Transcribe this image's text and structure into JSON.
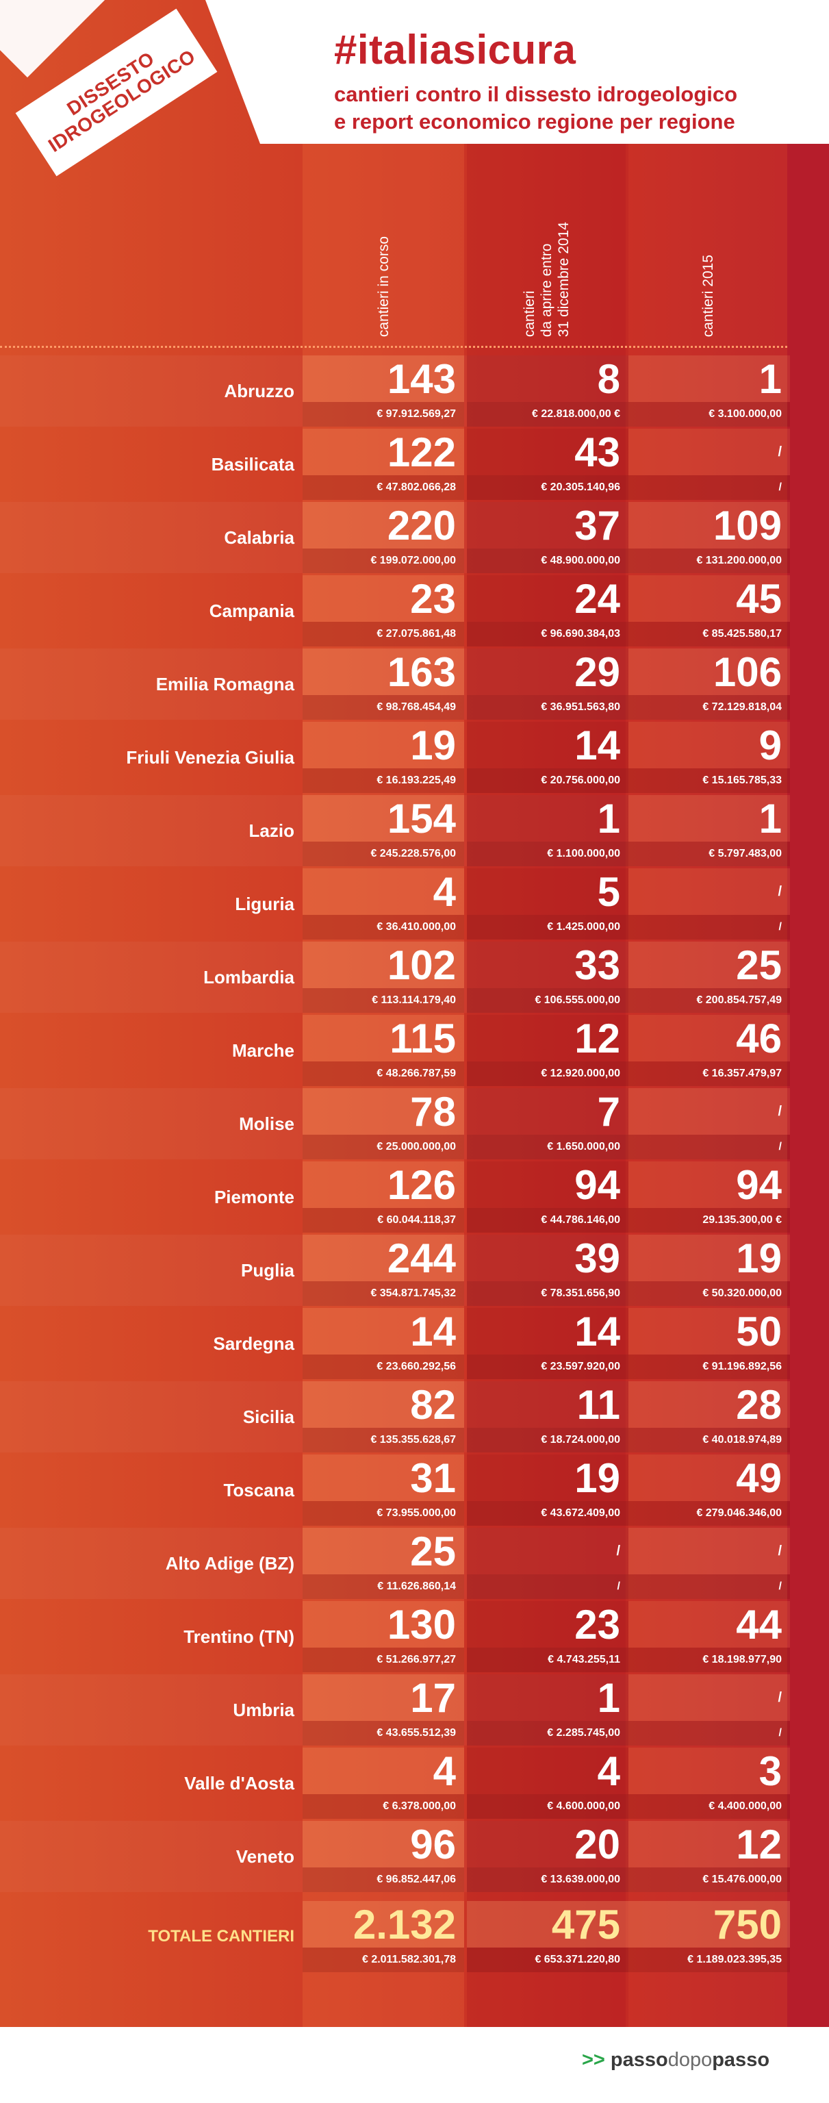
{
  "header": {
    "tag_line1": "DISSESTO",
    "tag_line2": "IDROGEOLOGICO",
    "title": "#italiasicura",
    "subtitle_line1": "cantieri contro il dissesto idrogeologico",
    "subtitle_line2": "e report economico regione per regione"
  },
  "columns": {
    "c1": "cantieri in corso",
    "c2_line1": "cantieri",
    "c2_line2": "da aprire entro",
    "c2_line3": "31 dicembre 2014",
    "c3": "cantieri 2015"
  },
  "colors": {
    "title_red": "#c4222a",
    "total_yellow": "#ffe89a",
    "logo_green": "#2aa64a"
  },
  "chart_data": {
    "type": "table",
    "title": "#italiasicura",
    "series_names": [
      "cantieri in corso",
      "cantieri da aprire entro 31 dicembre 2014",
      "cantieri 2015"
    ],
    "rows": [
      {
        "region": "Abruzzo",
        "v": [
          "143",
          "8",
          "1"
        ],
        "a": [
          "€ 97.912.569,27",
          "€ 22.818.000,00 €",
          "€ 3.100.000,00"
        ]
      },
      {
        "region": "Basilicata",
        "v": [
          "122",
          "43",
          ""
        ],
        "a": [
          "€ 47.802.066,28",
          "€ 20.305.140,96",
          "/"
        ],
        "top3": "/"
      },
      {
        "region": "Calabria",
        "v": [
          "220",
          "37",
          "109"
        ],
        "a": [
          "€ 199.072.000,00",
          "€ 48.900.000,00",
          "€ 131.200.000,00"
        ]
      },
      {
        "region": "Campania",
        "v": [
          "23",
          "24",
          "45"
        ],
        "a": [
          "€ 27.075.861,48",
          "€ 96.690.384,03",
          "€ 85.425.580,17"
        ]
      },
      {
        "region": "Emilia Romagna",
        "v": [
          "163",
          "29",
          "106"
        ],
        "a": [
          "€ 98.768.454,49",
          "€ 36.951.563,80",
          "€ 72.129.818,04"
        ]
      },
      {
        "region": "Friuli Venezia Giulia",
        "v": [
          "19",
          "14",
          "9"
        ],
        "a": [
          "€ 16.193.225,49",
          "€ 20.756.000,00",
          "€ 15.165.785,33"
        ]
      },
      {
        "region": "Lazio",
        "v": [
          "154",
          "1",
          "1"
        ],
        "a": [
          "€ 245.228.576,00",
          "€ 1.100.000,00",
          "€ 5.797.483,00"
        ]
      },
      {
        "region": "Liguria",
        "v": [
          "4",
          "5",
          ""
        ],
        "a": [
          "€ 36.410.000,00",
          "€ 1.425.000,00",
          "/"
        ],
        "top3": "/"
      },
      {
        "region": "Lombardia",
        "v": [
          "102",
          "33",
          "25"
        ],
        "a": [
          "€ 113.114.179,40",
          "€ 106.555.000,00",
          "€ 200.854.757,49"
        ]
      },
      {
        "region": "Marche",
        "v": [
          "115",
          "12",
          "46"
        ],
        "a": [
          "€ 48.266.787,59",
          "€ 12.920.000,00",
          "€ 16.357.479,97"
        ]
      },
      {
        "region": "Molise",
        "v": [
          "78",
          "7",
          ""
        ],
        "a": [
          "€ 25.000.000,00",
          "€ 1.650.000,00",
          "/"
        ],
        "top3": "/"
      },
      {
        "region": "Piemonte",
        "v": [
          "126",
          "94",
          "94"
        ],
        "a": [
          "€ 60.044.118,37",
          "€ 44.786.146,00",
          "29.135.300,00 €"
        ]
      },
      {
        "region": "Puglia",
        "v": [
          "244",
          "39",
          "19"
        ],
        "a": [
          "€ 354.871.745,32",
          "€ 78.351.656,90",
          "€ 50.320.000,00"
        ]
      },
      {
        "region": "Sardegna",
        "v": [
          "14",
          "14",
          "50"
        ],
        "a": [
          "€ 23.660.292,56",
          "€ 23.597.920,00",
          "€ 91.196.892,56"
        ]
      },
      {
        "region": "Sicilia",
        "v": [
          "82",
          "11",
          "28"
        ],
        "a": [
          "€ 135.355.628,67",
          "€ 18.724.000,00",
          "€ 40.018.974,89"
        ]
      },
      {
        "region": "Toscana",
        "v": [
          "31",
          "19",
          "49"
        ],
        "a": [
          "€ 73.955.000,00",
          "€ 43.672.409,00",
          "€ 279.046.346,00"
        ]
      },
      {
        "region": "Alto Adige (BZ)",
        "v": [
          "25",
          "",
          ""
        ],
        "a": [
          "€ 11.626.860,14",
          "/",
          "/"
        ],
        "top2": "/",
        "top3": "/"
      },
      {
        "region": "Trentino (TN)",
        "v": [
          "130",
          "23",
          "44"
        ],
        "a": [
          "€ 51.266.977,27",
          "€ 4.743.255,11",
          "€ 18.198.977,90"
        ]
      },
      {
        "region": "Umbria",
        "v": [
          "17",
          "1",
          ""
        ],
        "a": [
          "€ 43.655.512,39",
          "€ 2.285.745,00",
          "/"
        ],
        "top3": "/"
      },
      {
        "region": "Valle d'Aosta",
        "v": [
          "4",
          "4",
          "3"
        ],
        "a": [
          "€ 6.378.000,00",
          "€ 4.600.000,00",
          "€ 4.400.000,00"
        ]
      },
      {
        "region": "Veneto",
        "v": [
          "96",
          "20",
          "12"
        ],
        "a": [
          "€ 96.852.447,06",
          "€ 13.639.000,00",
          "€ 15.476.000,00"
        ]
      }
    ],
    "total": {
      "region": "TOTALE CANTIERI",
      "v": [
        "2.132",
        "475",
        "750"
      ],
      "a": [
        "€ 2.011.582.301,78",
        "€ 653.371.220,80",
        "€ 1.189.023.395,35"
      ]
    }
  },
  "footer": {
    "arrows": ">>",
    "brand_a": "passo",
    "brand_b": "dopo",
    "brand_c": "passo"
  }
}
